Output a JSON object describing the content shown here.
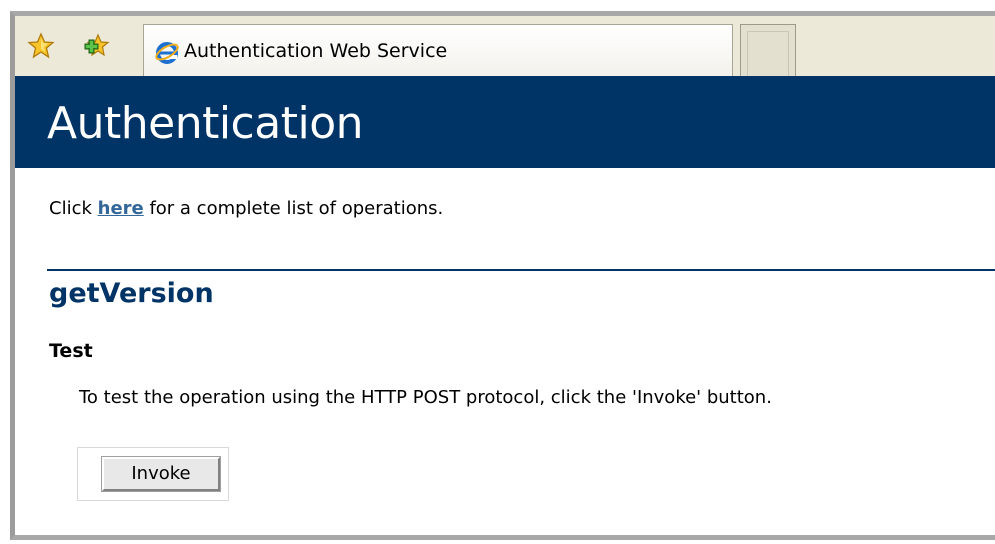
{
  "browser": {
    "tab_title": "Authentication Web Service",
    "icons": {
      "favorites": "favorites-star-icon",
      "add_favorites": "add-to-favorites-icon",
      "tab_page": "internet-explorer-icon"
    }
  },
  "header": {
    "title": "Authentication"
  },
  "intro": {
    "prefix": "Click ",
    "link_text": "here",
    "suffix": " for a complete list of operations."
  },
  "operation": {
    "name": "getVersion",
    "test_heading": "Test",
    "test_description": "To test the operation using the HTTP POST protocol, click the 'Invoke' button.",
    "invoke_label": "Invoke"
  },
  "colors": {
    "banner": "#003366",
    "heading": "#003366",
    "link": "#336699",
    "toolbar": "#ece9d8"
  }
}
